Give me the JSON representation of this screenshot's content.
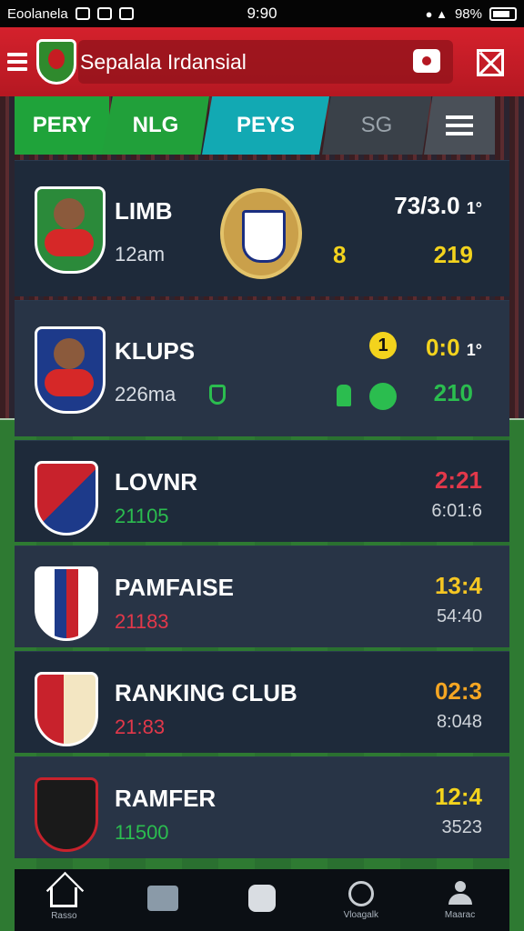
{
  "status_bar": {
    "carrier": "Eoolanela",
    "time": "9:90",
    "battery": "98%"
  },
  "header": {
    "title": "Sepalala Irdansial"
  },
  "tabs": [
    {
      "label": "PERY"
    },
    {
      "label": "NLG"
    },
    {
      "label": "PEYS"
    },
    {
      "label": "SG"
    }
  ],
  "matches": [
    {
      "name": "LIMB",
      "sub": "12am",
      "score": "73/3.0",
      "score_suffix": "1°",
      "detail_left": "8",
      "detail_right": "219"
    },
    {
      "name": "KLUPS",
      "sub": "226ma",
      "score": "0:0",
      "score_suffix": "1°",
      "dot_left": "1",
      "detail_right": "210"
    },
    {
      "name": "LOVNR",
      "sub": "21105",
      "score": "2:21",
      "time": "6:01:6"
    },
    {
      "name": "PAMFAISE",
      "sub": "21183",
      "score": "13:4",
      "time": "54:40"
    },
    {
      "name": "RANKING CLUB",
      "sub": "21:83",
      "score": "02:3",
      "time": "8:048"
    },
    {
      "name": "RAMFER",
      "sub": "11500",
      "score": "12:4",
      "time": "3523"
    }
  ],
  "colors": {
    "header_red": "#d4212c",
    "tab_green": "#1fa33a",
    "tab_teal": "#12a9b3",
    "card_bg": "#1e2a3a",
    "score_yellow": "#f3d31d",
    "score_red": "#e2384a",
    "score_orange": "#f5a623"
  },
  "nav": [
    {
      "label": "Rasso",
      "icon": "home-icon"
    },
    {
      "label": "",
      "icon": "grid-icon"
    },
    {
      "label": "",
      "icon": "blob-icon"
    },
    {
      "label": "Vloagalk",
      "icon": "pin-icon"
    },
    {
      "label": "Maarac",
      "icon": "user-icon"
    }
  ]
}
